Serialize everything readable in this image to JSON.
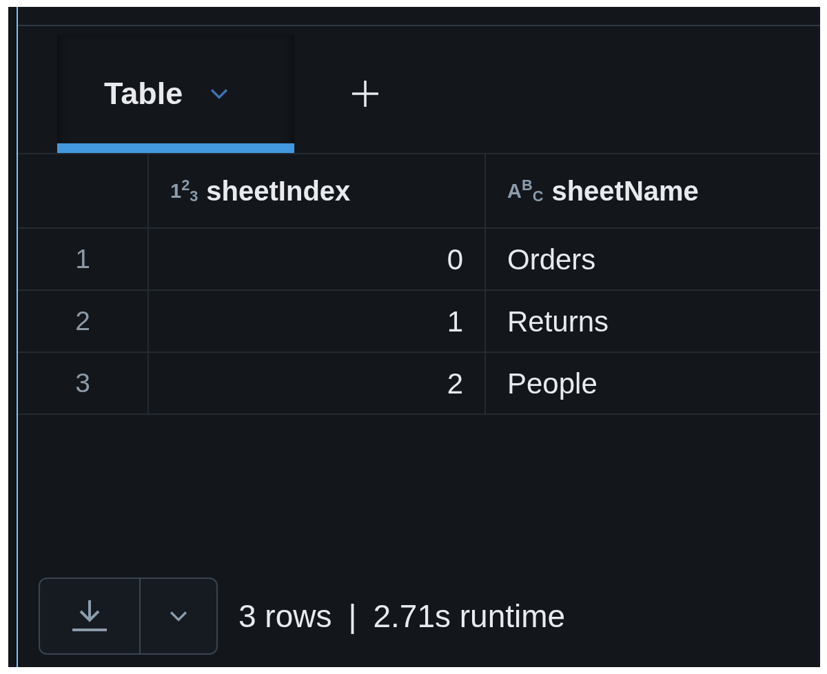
{
  "tabs": [
    {
      "label": "Table",
      "selected": true
    }
  ],
  "table": {
    "columns": [
      {
        "label": "sheetIndex",
        "kind": "number",
        "type_glyph": "1$^{2}$$_{3}$"
      },
      {
        "label": "sheetName",
        "kind": "text",
        "type_glyph": "A$^{B}$$_{C}$"
      }
    ],
    "rows": [
      {
        "number": "1",
        "cells": [
          "0",
          "Orders"
        ]
      },
      {
        "number": "2",
        "cells": [
          "1",
          "Returns"
        ]
      },
      {
        "number": "3",
        "cells": [
          "2",
          "People"
        ]
      }
    ]
  },
  "footer": {
    "row_count": "3 rows",
    "separator": "|",
    "runtime": "2.71s runtime"
  }
}
